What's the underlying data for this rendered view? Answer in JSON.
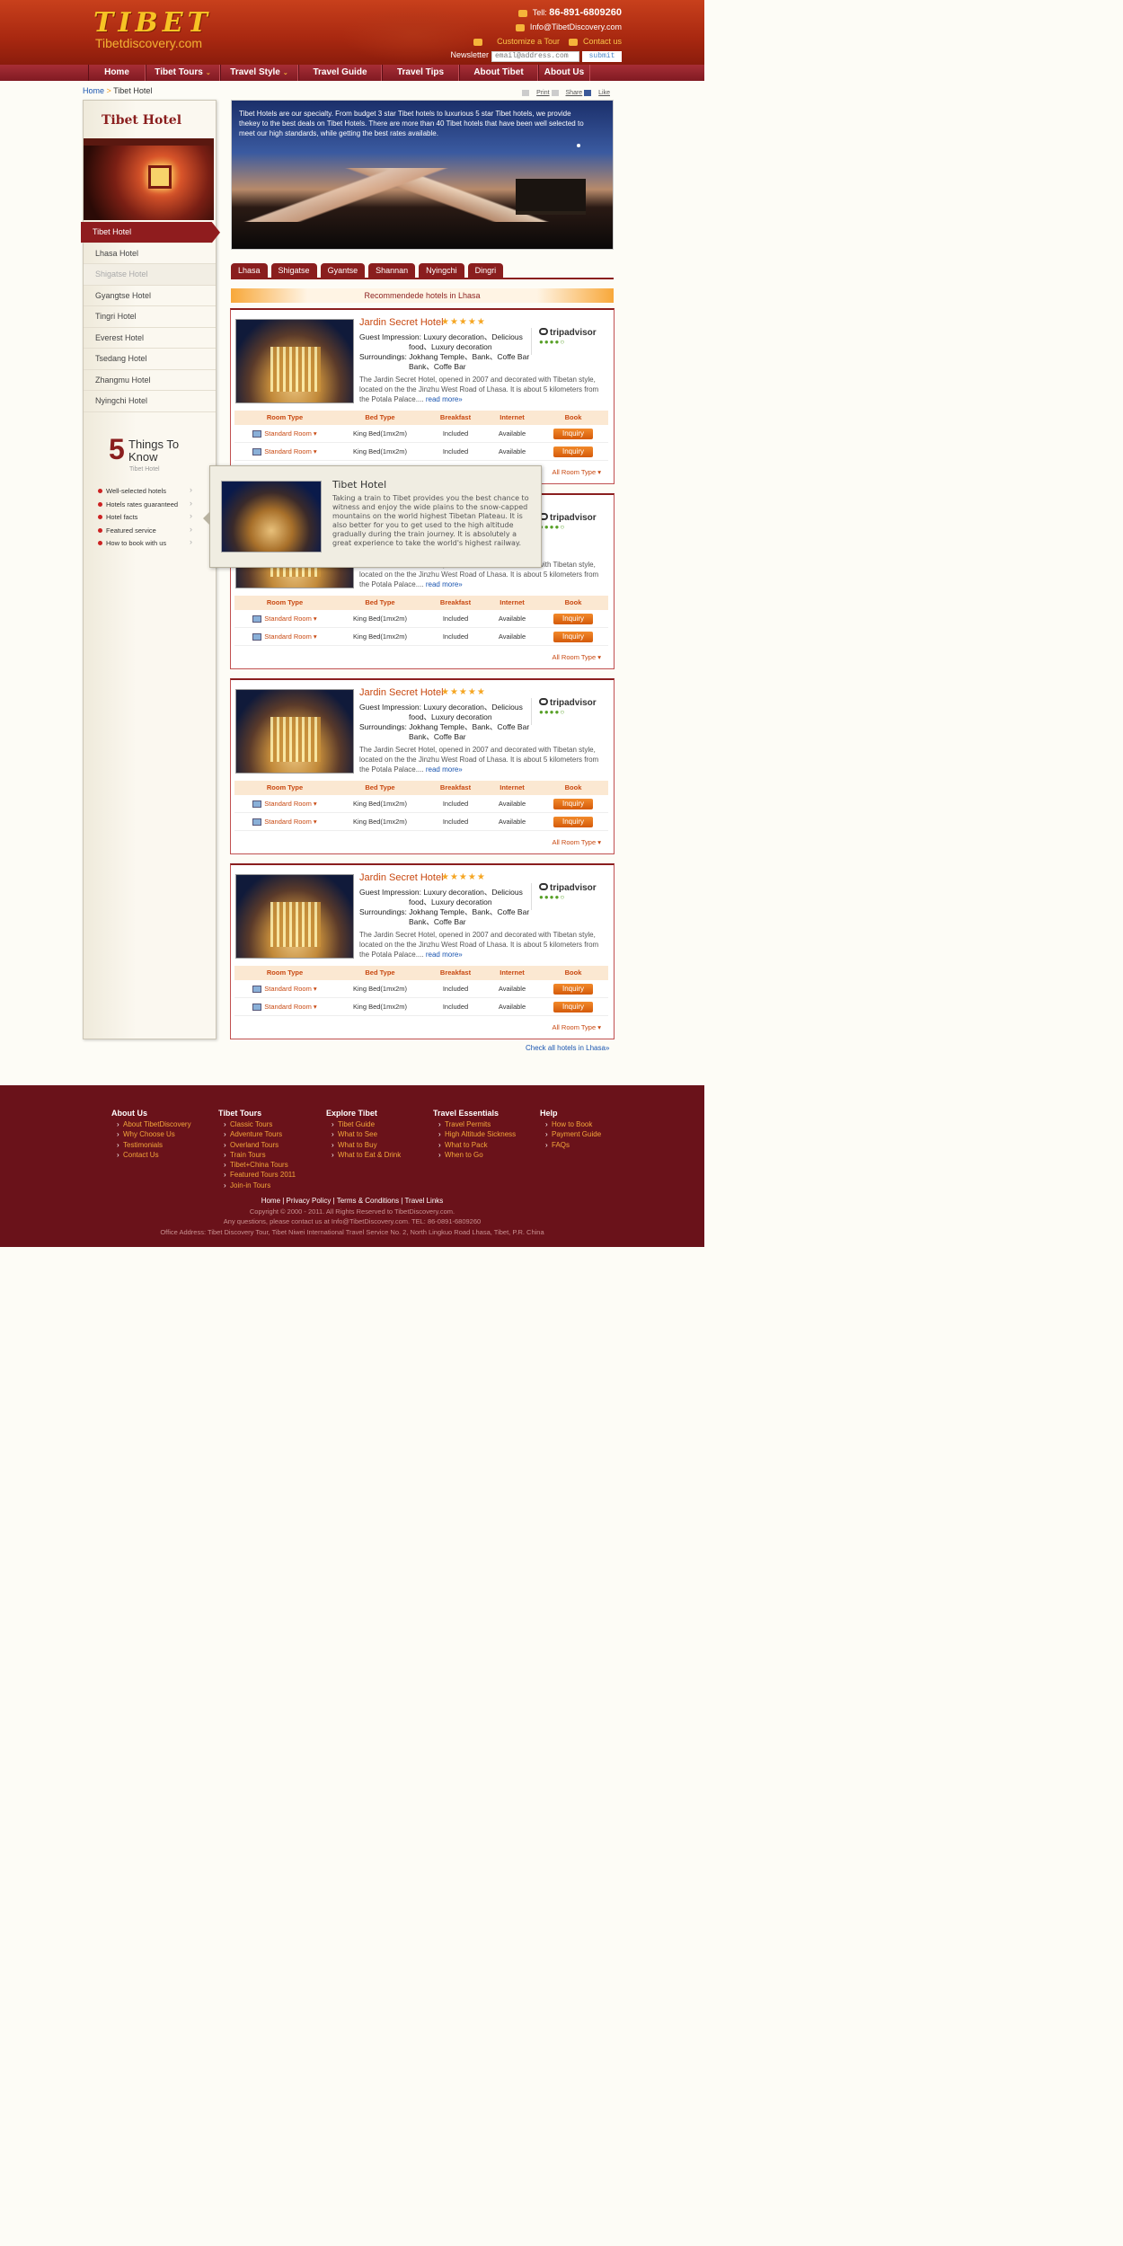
{
  "header": {
    "logo_title": "TIBET",
    "logo_site": "Tibetdiscovery.com",
    "tel_label": "Tell:",
    "tel": "86-891-6809260",
    "email": "Info@TibetDiscovery.com",
    "customize": "Customize a Tour",
    "contact": "Contact us",
    "newsletter_label": "Newsletter",
    "newsletter_placeholder": "email@address.com",
    "submit": "submit"
  },
  "nav": [
    {
      "label": "Home",
      "w": 64,
      "caret": ""
    },
    {
      "label": "Tibet Tours",
      "w": 83,
      "caret": "⌄"
    },
    {
      "label": "Travel Style",
      "w": 87,
      "caret": "⌄"
    },
    {
      "label": "Travel Guide",
      "w": 93,
      "caret": ""
    },
    {
      "label": "Travel Tips",
      "w": 86,
      "caret": ""
    },
    {
      "label": "About Tibet",
      "w": 88,
      "caret": ""
    },
    {
      "label": "About Us",
      "w": 58,
      "caret": ""
    }
  ],
  "breadcrumb": {
    "home": "Home",
    "sep": ">",
    "current": "Tibet Hotel"
  },
  "share": {
    "print": "Print",
    "share": "Share",
    "like": "Like"
  },
  "sidebar": {
    "title": "Tibet Hotel",
    "items": [
      "Tibet Hotel",
      "Lhasa Hotel",
      "Shigatse Hotel",
      "Gyangtse Hotel",
      "Tingri Hotel",
      "Everest Hotel",
      "Tsedang Hotel",
      "Zhangmu Hotel",
      "Nyingchi Hotel"
    ],
    "five_num": "5",
    "five_text": "Things To Know",
    "five_sub": "Tibet Hotel",
    "know": [
      "Well-selected hotels",
      "Hotels rates guaranteed",
      "Hotel facts",
      "Featured service",
      "How to book with us"
    ]
  },
  "banner": {
    "text": "Tibet Hotels are our specialty. From budget 3 star Tibet hotels to luxurious 5 star Tibet hotels, we provide thekey to the best deals on Tibet Hotels. There are more than 40 Tibet hotels that have been well selected to meet our high standards, while getting the best rates available."
  },
  "tabs": [
    "Lhasa",
    "Shigatse",
    "Gyantse",
    "Shannan",
    "Nyingchi",
    "Dingri"
  ],
  "recommended": "Recommendede hotels in Lhasa",
  "hotel": {
    "name": "Jardin Secret Hotel",
    "stars": "★★★★★",
    "impression": "Guest Impression: Luxury decoration、Delicious",
    "impression2": "food、Luxury decoration",
    "surroundings": "Surroundings: Jokhang Temple、Bank、Coffe Bar",
    "surroundings2": "Bank、Coffe Bar",
    "desc": "The Jardin Secret Hotel, opened in 2007 and decorated with Tibetan style, located on the the Jinzhu West Road of Lhasa. It is about 5 kilometers from the Potala Palace....",
    "read_more": "read more»",
    "tripadvisor": "tripadvisor",
    "rating": "●●●●○",
    "headers": {
      "room": "Room Type",
      "bed": "Bed Type",
      "breakfast": "Breakfast",
      "internet": "Internet",
      "book": "Book"
    },
    "room": "Standard Room ▾",
    "bed": "King Bed(1mx2m)",
    "breakfast_val": "Included",
    "internet_val": "Available",
    "inquiry": "Inquiry",
    "all_room": "All Room Type ▾"
  },
  "check_all": "Check all hotels in Lhasa»",
  "popup": {
    "title": "Tibet Hotel",
    "text": "Taking a train to Tibet provides you the best chance to witness and enjoy the wide plains to the snow-capped mountains on the world highest Tibetan Plateau. It is also better for you to get used to the high altitude gradually during the train journey. It is absolutely a great experience to take the world's highest railway."
  },
  "footer": {
    "cols": [
      {
        "title": "About Us",
        "items": [
          "About TibetDiscovery",
          "Why Choose Us",
          "Testimonials",
          "Contact Us"
        ]
      },
      {
        "title": "Tibet Tours",
        "items": [
          "Classic Tours",
          "Adventure Tours",
          "Overland Tours",
          "Train Tours",
          "Tibet+China Tours",
          "Featured Tours 2011",
          "Join-in Tours"
        ]
      },
      {
        "title": "Explore Tibet",
        "items": [
          "Tibet Guide",
          "What to See",
          "What to Buy",
          "What to Eat & Drink"
        ]
      },
      {
        "title": "Travel Essentials",
        "items": [
          "Travel Permits",
          "High Altitude Sickness",
          "What to Pack",
          "When to Go"
        ]
      },
      {
        "title": "Help",
        "items": [
          "How to Book",
          "Payment Guide",
          "FAQs"
        ]
      }
    ],
    "links": "Home | Privacy Policy | Terms & Conditions | Travel Links",
    "copyright": "Copyright © 2000 - 2011. All Rights Reserved to TibetDiscovery.com.",
    "contact": "Any questions, please contact us at Info@TibetDiscovery.com. TEL: 86-0891-6809260",
    "address": "Office Address: Tibet Discovery Tour, Tibet Niwei International Travel Service No. 2, North Lingkuo Road Lhasa, Tibet, P.R. China"
  }
}
